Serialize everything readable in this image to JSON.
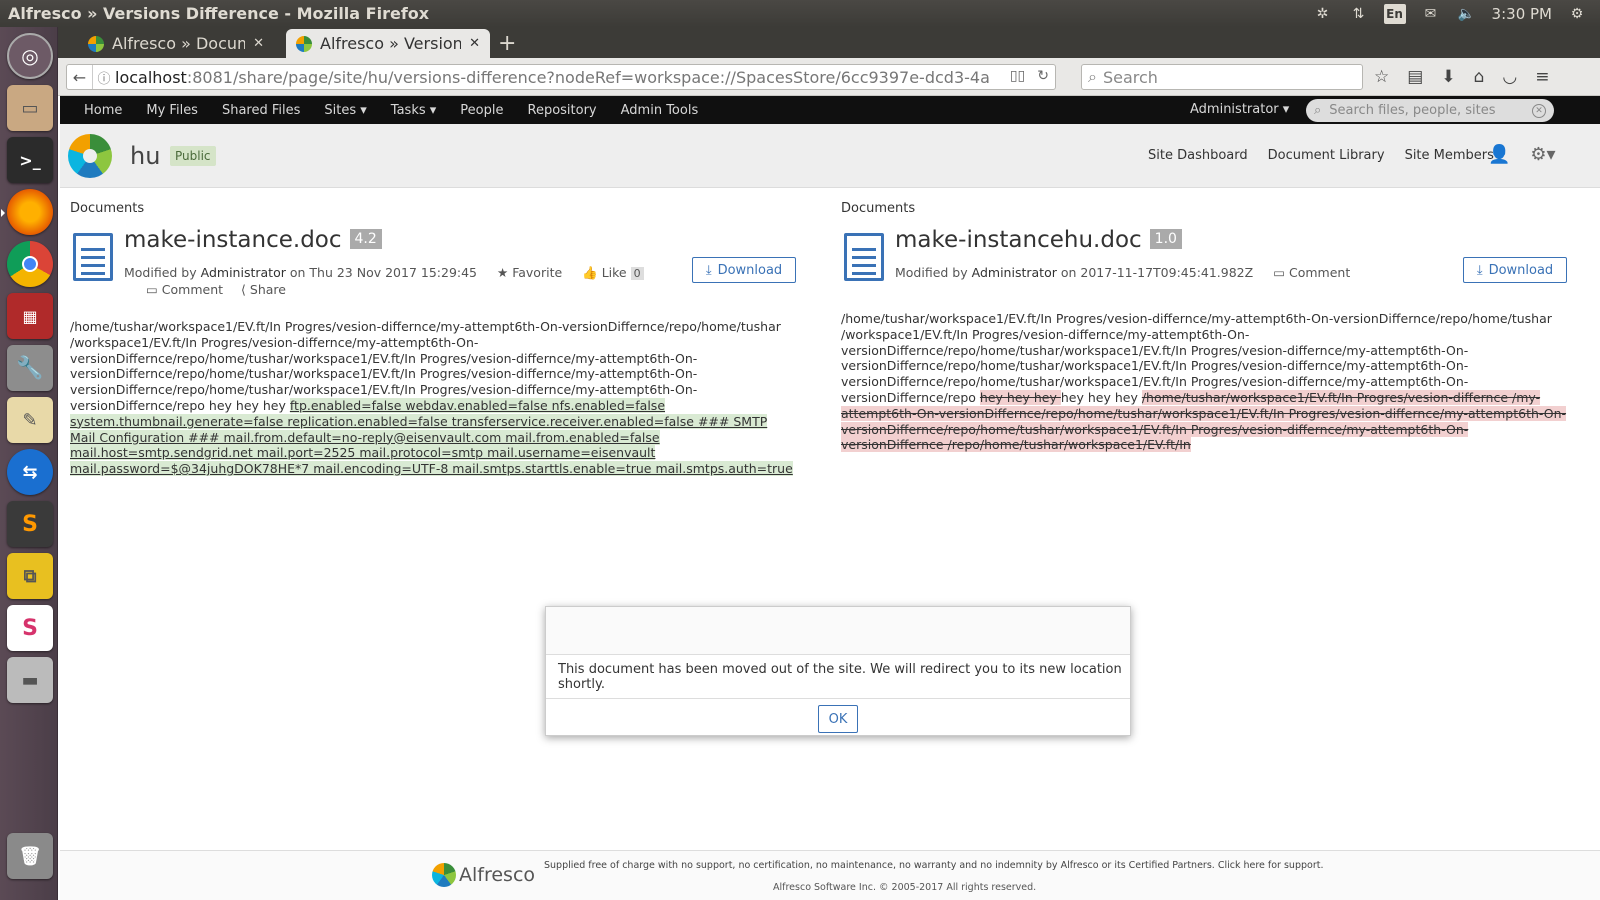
{
  "window": {
    "title": "Alfresco » Versions Difference - Mozilla Firefox",
    "clock": "3:30 PM",
    "keyboard": "En"
  },
  "launcher": {
    "icons": [
      "ubuntu-dash-icon",
      "files-icon",
      "terminal-icon",
      "firefox-icon",
      "chrome-icon",
      "mysql-workbench-icon",
      "system-settings-icon",
      "text-editor-icon",
      "teamviewer-icon",
      "sublime-text-icon",
      "vmware-icon",
      "slack-icon",
      "disk-icon",
      "trash-icon"
    ]
  },
  "browser": {
    "tabs": [
      {
        "label": "Alfresco » Documen",
        "close": "✕"
      },
      {
        "label": "Alfresco » Versions",
        "close": "✕"
      }
    ],
    "new_tab": "+",
    "url_host": "localhost",
    "url_path": ":8081/share/page/site/hu/versions-difference?nodeRef=workspace://SpacesStore/6cc9397e-dcd3-4a",
    "search_placeholder": "Search"
  },
  "alfresco": {
    "menu": [
      "Home",
      "My Files",
      "Shared Files",
      "Sites ▾",
      "Tasks ▾",
      "People",
      "Repository",
      "Admin Tools"
    ],
    "user": "Administrator ▾",
    "search_placeholder": "Search files, people, sites",
    "site_name": "hu",
    "site_visibility": "Public",
    "site_nav": [
      "Site Dashboard",
      "Document Library",
      "Site Members"
    ]
  },
  "left_doc": {
    "section": "Documents",
    "name": "make-instance.doc",
    "version": "4.2",
    "modified_prefix": "Modified by",
    "modified_by": "Administrator",
    "modified_on": "on Thu 23 Nov 2017 15:29:45",
    "favorite": "Favorite",
    "like": "Like",
    "like_count": "0",
    "comment": "Comment",
    "share": "Share",
    "download": "Download",
    "diff_plain": "/home/tushar/workspace1/EV.ft/In Progres/vesion-differnce/my-attempt6th-On-versionDiffernce/repo/home/tushar /workspace1/EV.ft/In Progres/vesion-differnce/my-attempt6th-On-versionDiffernce/repo/home/tushar/workspace1/EV.ft/In Progres/vesion-differnce/my-attempt6th-On-versionDiffernce/repo/home/tushar/workspace1/EV.ft/In Progres/vesion-differnce/my-attempt6th-On-versionDiffernce/repo/home/tushar/workspace1/EV.ft/In Progres/vesion-differnce/my-attempt6th-On-versionDiffernce/repo hey hey hey ",
    "diff_added": "ftp.enabled=false webdav.enabled=false nfs.enabled=false system.thumbnail.generate=false replication.enabled=false transferservice.receiver.enabled=false ### SMTP Mail Configuration ### mail.from.default=no-reply@eisenvault.com mail.from.enabled=false mail.host=smtp.sendgrid.net mail.port=2525 mail.protocol=smtp mail.username=eisenvault mail.password=$@34juhgDOK78HE*7 mail.encoding=UTF-8 mail.smtps.starttls.enable=true mail.smtps.auth=true"
  },
  "right_doc": {
    "section": "Documents",
    "name": "make-instancehu.doc",
    "version": "1.0",
    "modified_prefix": "Modified by",
    "modified_by": "Administrator",
    "modified_on": "on 2017-11-17T09:45:41.982Z",
    "comment": "Comment",
    "download": "Download",
    "diff_plain": "/home/tushar/workspace1/EV.ft/In Progres/vesion-differnce/my-attempt6th-On-versionDiffernce/repo/home/tushar /workspace1/EV.ft/In Progres/vesion-differnce/my-attempt6th-On-versionDiffernce/repo/home/tushar/workspace1/EV.ft/In Progres/vesion-differnce/my-attempt6th-On-versionDiffernce/repo/home/tushar/workspace1/EV.ft/In Progres/vesion-differnce/my-attempt6th-On-versionDiffernce/repo/home/tushar/workspace1/EV.ft/In Progres/vesion-differnce/my-attempt6th-On-versionDiffernce/repo ",
    "diff_deleted_1": "hey hey hey ",
    "diff_plain_2": "hey hey hey ",
    "diff_deleted_2": "/home/tushar/workspace1/EV.ft/In Progres/vesion-differnce /my-attempt6th-On-versionDiffernce/repo/home/tushar/workspace1/EV.ft/In Progres/vesion-differnce/my-attempt6th-On-versionDiffernce/repo/home/tushar/workspace1/EV.ft/In Progres/vesion-differnce/my-attempt6th-On-versionDiffernce /repo/home/tushar/workspace1/EV.ft/In"
  },
  "dialog": {
    "message": "This document has been moved out of the site. We will redirect you to its new location shortly.",
    "ok": "OK"
  },
  "footer": {
    "brand": "Alfresco",
    "line1": "Supplied free of charge with no support, no certification, no maintenance, no warranty and no indemnity by Alfresco or its Certified Partners. Click here for support.",
    "line2": "Alfresco Software Inc. © 2005-2017 All rights reserved."
  },
  "colors": {
    "accent": "#3a72b6",
    "added_bg": "#d9ead3",
    "deleted_bg": "#f2d0d0",
    "header_bg": "#101010"
  }
}
